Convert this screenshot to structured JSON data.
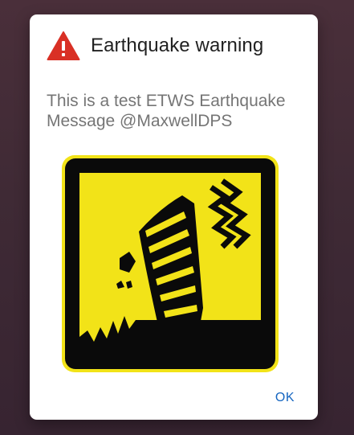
{
  "dialog": {
    "title": "Earthquake warning",
    "title_icon": "warning-triangle-icon",
    "message": "This is a test ETWS Earthquake Message @MaxwellDPS",
    "image": "earthquake-pictogram",
    "ok_label": "OK"
  },
  "colors": {
    "warning_icon": "#d93025",
    "pictogram_yellow": "#f2e318",
    "pictogram_black": "#0a0a0a",
    "button_text": "#1565c0",
    "title_text": "#212121",
    "message_text": "#757575",
    "background": "#3f2a35"
  }
}
